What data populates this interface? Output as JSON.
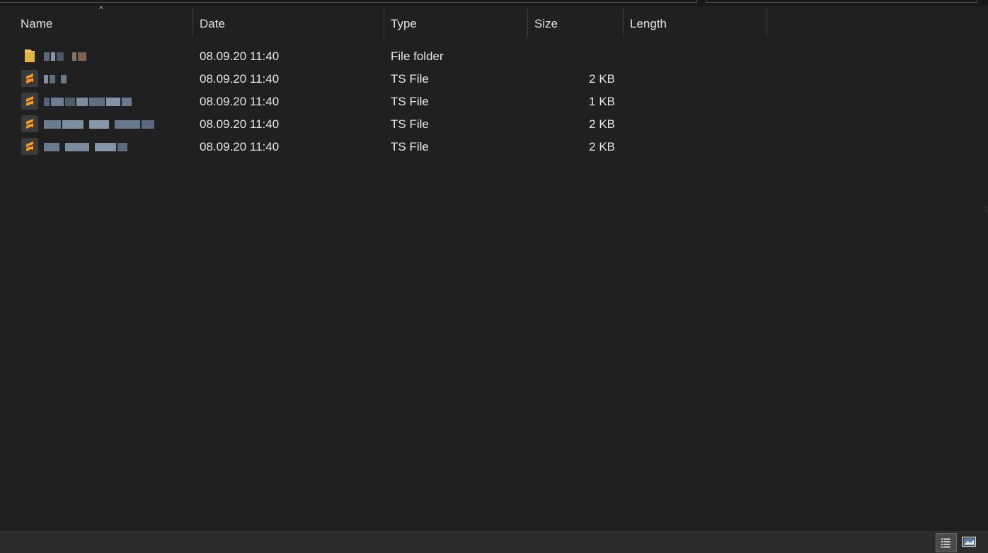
{
  "columns": {
    "name": "Name",
    "date": "Date",
    "type": "Type",
    "size": "Size",
    "length": "Length"
  },
  "sort_indicator": "^",
  "rows": [
    {
      "icon": "folder-icon",
      "date": "08.09.20 11:40",
      "type": "File folder",
      "size": ""
    },
    {
      "icon": "sublime-text-file-icon",
      "date": "08.09.20 11:40",
      "type": "TS File",
      "size": "2 KB"
    },
    {
      "icon": "sublime-text-file-icon",
      "date": "08.09.20 11:40",
      "type": "TS File",
      "size": "1 KB"
    },
    {
      "icon": "sublime-text-file-icon",
      "date": "08.09.20 11:40",
      "type": "TS File",
      "size": "2 KB"
    },
    {
      "icon": "sublime-text-file-icon",
      "date": "08.09.20 11:40",
      "type": "TS File",
      "size": "2 KB"
    }
  ],
  "colors": {
    "background": "#202020",
    "text": "#e6e6e6",
    "folder": "#f0c75e",
    "sublime_orange": "#f89c1c"
  }
}
